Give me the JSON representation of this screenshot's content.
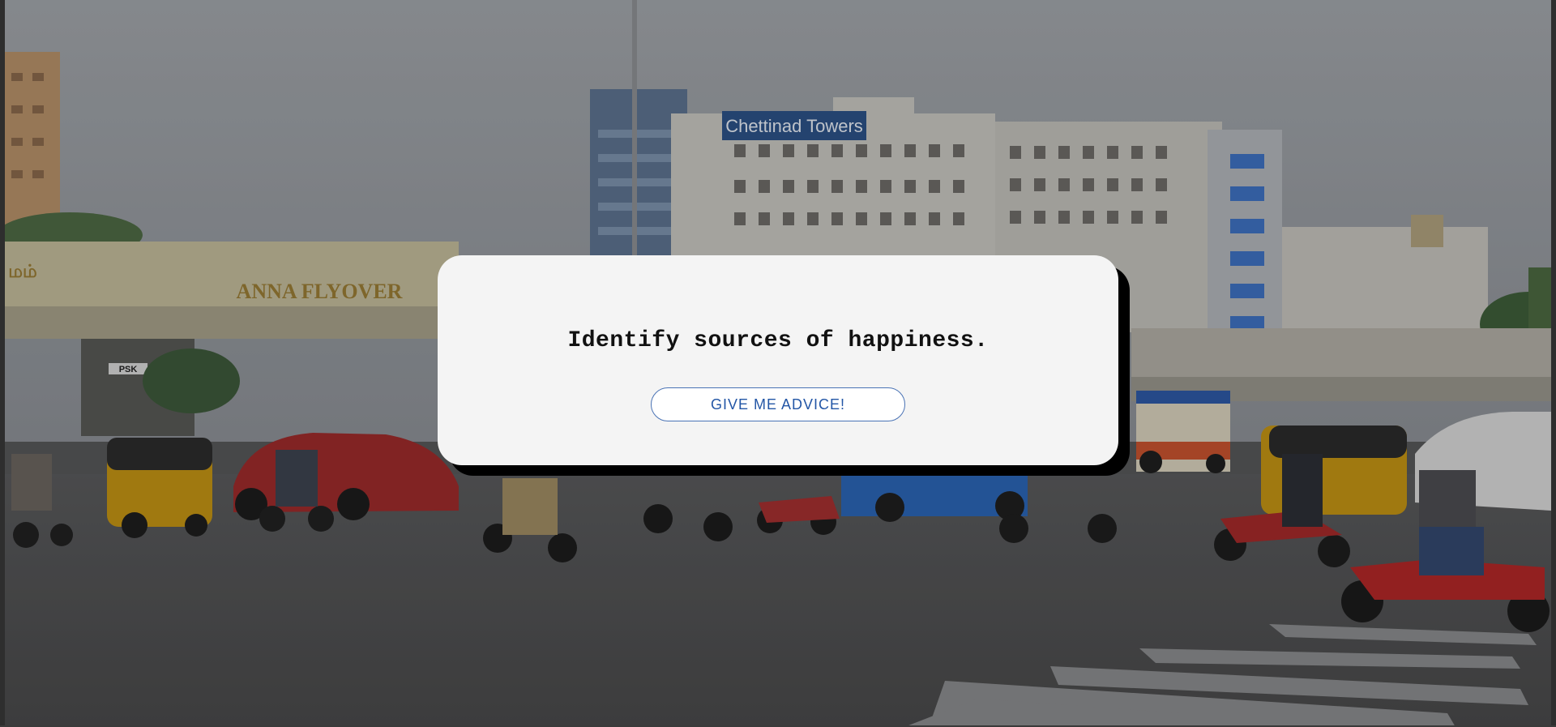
{
  "background": {
    "sign_flyover": "ANNA FLYOVER",
    "sign_tower": "Chettinad Towers",
    "sign_psk": "PSK",
    "sign_partial": "மம்"
  },
  "advice": {
    "text": "Identify sources of happiness.",
    "button_label": "GIVE ME ADVICE!"
  },
  "colors": {
    "card_bg": "#f4f4f4",
    "card_shadow": "#000000",
    "button_border": "#4a73b5",
    "button_text": "#2356a6"
  }
}
